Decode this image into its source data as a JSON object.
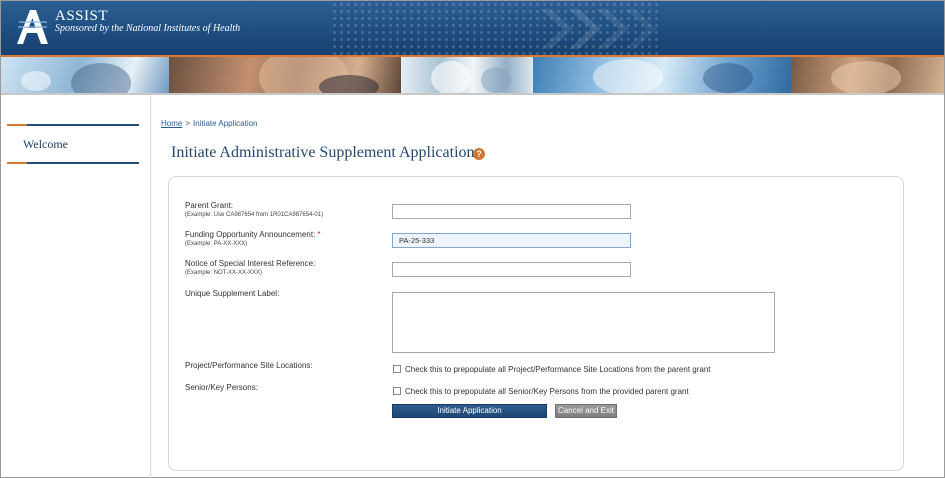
{
  "header": {
    "title": "ASSIST",
    "subtitle": "Sponsored by the National Institutes of Health",
    "logo_icon": "assist-a-logo-icon"
  },
  "sidebar": {
    "items": [
      {
        "label": "Welcome"
      }
    ]
  },
  "breadcrumb": {
    "home": "Home",
    "separator": ">",
    "current": "Initiate Application"
  },
  "page": {
    "title": "Initiate Administrative Supplement Application",
    "help_glyph": "?"
  },
  "form": {
    "parent_grant": {
      "label": "Parent Grant:",
      "example": "(Example: Use CA987654 from 1R01CA987654-01)",
      "value": ""
    },
    "foa": {
      "label": "Funding Opportunity Announcement:",
      "required_mark": "*",
      "example": "(Example: PA-XX-XXX)",
      "value": "PA-25-333"
    },
    "nosi": {
      "label": "Notice of Special Interest Reference:",
      "example": "(Example: NOT-XX-XX-XXX)",
      "value": ""
    },
    "supplement_label": {
      "label": "Unique Supplement Label:",
      "value": ""
    },
    "site_locations": {
      "label": "Project/Performance Site Locations:",
      "checkbox_text": "Check this to prepopulate all Project/Performance Site Locations from the parent grant",
      "checked": false
    },
    "key_persons": {
      "label": "Senior/Key Persons:",
      "checkbox_text": "Check this to prepopulate all Senior/Key Persons from the provided parent grant",
      "checked": false
    },
    "buttons": {
      "initiate": "Initiate Application",
      "cancel": "Cancel and Exit"
    }
  },
  "colors": {
    "header_blue": "#1e4d80",
    "accent_orange": "#d97a36",
    "title_blue": "#24476f",
    "primary_button": "#1e4672",
    "secondary_button": "#8a8a8a"
  }
}
